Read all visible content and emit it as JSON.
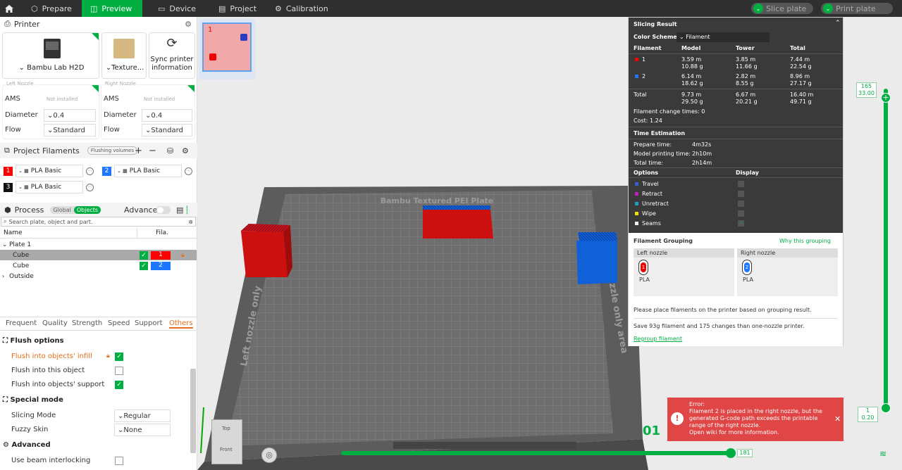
{
  "topbar": {
    "tabs": [
      "Prepare",
      "Preview",
      "Device",
      "Project",
      "Calibration"
    ],
    "slice_plate": "Slice plate",
    "print_plate": "Print plate"
  },
  "printer": {
    "section_title": "Printer",
    "printer_name": "Bambu Lab H2D",
    "plate_type": "Texture...",
    "sync_label": "Sync printer information",
    "left_nozzle": {
      "title": "Left Nozzle",
      "ams_label": "AMS",
      "ams_value": "Not installed",
      "diameter_label": "Diameter",
      "diameter": "0.4",
      "flow_label": "Flow",
      "flow": "Standard"
    },
    "right_nozzle": {
      "title": "Right Nozzle",
      "ams_label": "AMS",
      "ams_value": "Not installed",
      "diameter_label": "Diameter",
      "diameter": "0.4",
      "flow_label": "Flow",
      "flow": "Standard"
    }
  },
  "filaments": {
    "section_title": "Project Filaments",
    "flushing": "Flushing volumes",
    "items": [
      {
        "num": "1",
        "color": "#ff0000",
        "name": "PLA Basic"
      },
      {
        "num": "2",
        "color": "#1e78ff",
        "name": "PLA Basic"
      },
      {
        "num": "3",
        "color": "#111111",
        "name": "PLA Basic"
      }
    ]
  },
  "process": {
    "section_title": "Process",
    "global": "Global",
    "objects": "Objects",
    "advanced": "Advanced",
    "search_placeholder": "Search plate, object and part.",
    "col_name": "Name",
    "col_fila": "Fila.",
    "plate": "Plate 1",
    "objects_list": [
      {
        "name": "Cube",
        "fila": "1",
        "color": "#ff0000"
      },
      {
        "name": "Cube",
        "fila": "2",
        "color": "#1e78ff"
      }
    ],
    "outside": "Outside"
  },
  "settings_tabs": [
    "Frequent",
    "Quality",
    "Strength",
    "Speed",
    "Support",
    "Others"
  ],
  "others": {
    "flush_options": "Flush options",
    "flush_infill": "Flush into objects' infill",
    "flush_this": "Flush into this object",
    "flush_support": "Flush into objects' support",
    "special_mode": "Special mode",
    "slicing_mode_label": "Slicing Mode",
    "slicing_mode": "Regular",
    "fuzzy_skin_label": "Fuzzy Skin",
    "fuzzy_skin": "None",
    "advanced": "Advanced",
    "beam": "Use beam interlocking"
  },
  "viewport": {
    "plate_thumb_number": "1",
    "bed_label": "Bambu Textured PEI Plate",
    "left_area": "Left nozzle only",
    "right_area": "nozzle only area",
    "cube_top": "Top",
    "cube_front": "Front",
    "layer_number": "01",
    "h_slider_value": "181"
  },
  "slicing_result": {
    "title": "Slicing Result",
    "color_scheme_label": "Color Scheme",
    "color_scheme": "Filament",
    "headers": [
      "Filament",
      "Model",
      "Tower",
      "Total"
    ],
    "rows": [
      {
        "name": "1",
        "color": "#ff0000",
        "model": [
          "3.59 m",
          "10.88 g"
        ],
        "tower": [
          "3.85 m",
          "11.66 g"
        ],
        "total": [
          "7.44 m",
          "22.54 g"
        ]
      },
      {
        "name": "2",
        "color": "#1e78ff",
        "model": [
          "6.14 m",
          "18.62 g"
        ],
        "tower": [
          "2.82 m",
          "8.55 g"
        ],
        "total": [
          "8.96 m",
          "27.17 g"
        ]
      },
      {
        "name": "Total",
        "color": "",
        "model": [
          "9.73 m",
          "29.50 g"
        ],
        "tower": [
          "6.67 m",
          "20.21 g"
        ],
        "total": [
          "16.40 m",
          "49.71 g"
        ]
      }
    ],
    "changes": "Filament change times:  0",
    "cost": "Cost:  1.24",
    "time_title": "Time Estimation",
    "prepare_label": "Prepare time:",
    "prepare": "4m32s",
    "model_label": "Model printing time:",
    "model": "2h10m",
    "total_label": "Total time:",
    "total": "2h14m",
    "options_title": "Options",
    "display_title": "Display",
    "options": [
      {
        "name": "Travel",
        "color": "#3a5fcd",
        "checked": false
      },
      {
        "name": "Retract",
        "color": "#c020c0",
        "checked": false
      },
      {
        "name": "Unretract",
        "color": "#20a0c0",
        "checked": false
      },
      {
        "name": "Wipe",
        "color": "#f0e000",
        "checked": false
      },
      {
        "name": "Seams",
        "color": "#eeeeee",
        "checked": true
      }
    ],
    "grouping_title": "Filament Grouping",
    "why": "Why this grouping",
    "left_nozzle": "Left nozzle",
    "right_nozzle": "Right nozzle",
    "left_material": "PLA",
    "right_material": "PLA",
    "left_num": "1",
    "right_num": "2",
    "place_msg": "Please place filaments on the printer based on grouping result.",
    "save_msg": "Save 93g filament and 175 changes than one-nozzle printer.",
    "regroup": "Regroup filament"
  },
  "error": {
    "title": "Error:",
    "message": "Filament 2 is placed in the right nozzle, but the generated G-code path exceeds the printable range of the right nozzle.",
    "link": "Open wiki for more information."
  },
  "vslider": {
    "top_layer": "165",
    "top_height": "33.00",
    "bottom_layer": "1",
    "bottom_height": "0.20"
  }
}
